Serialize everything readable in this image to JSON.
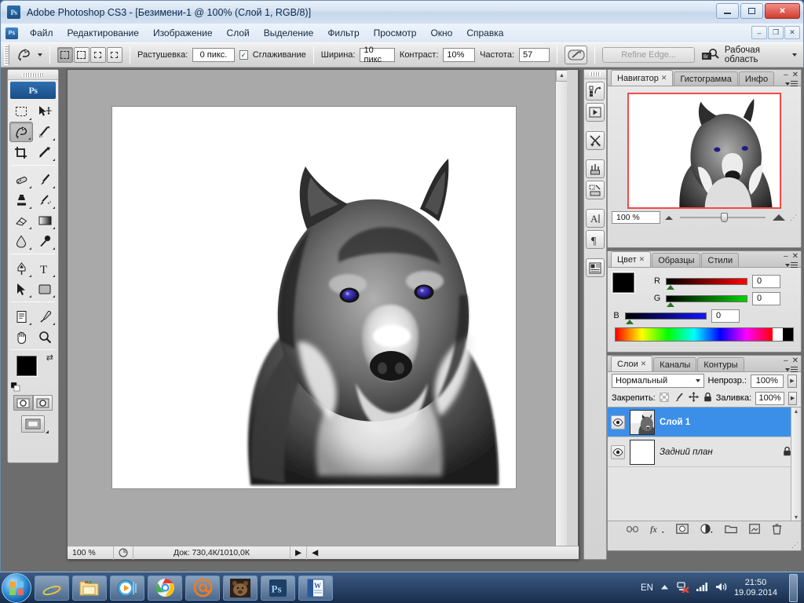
{
  "window": {
    "app_icon": "ps-icon",
    "title": "Adobe Photoshop CS3 - [Безимени-1 @ 100% (Слой 1, RGB/8)]",
    "minimize": "–",
    "maximize": "□",
    "close": "✕",
    "doc_minimize": "–",
    "doc_restore": "❐",
    "doc_close": "✕"
  },
  "menu": {
    "items": [
      {
        "label": "Файл"
      },
      {
        "label": "Редактирование"
      },
      {
        "label": "Изображение"
      },
      {
        "label": "Слой"
      },
      {
        "label": "Выделение"
      },
      {
        "label": "Фильтр"
      },
      {
        "label": "Просмотр"
      },
      {
        "label": "Окно"
      },
      {
        "label": "Справка"
      }
    ]
  },
  "options_bar": {
    "tool_preset": "magnetic-lasso-tool",
    "feather_label": "Растушевка:",
    "feather_value": "0 пикс.",
    "antialias_label": "Сглаживание",
    "antialias_checked": true,
    "width_label": "Ширина:",
    "width_value": "10 пикс",
    "contrast_label": "Контраст:",
    "contrast_value": "10%",
    "frequency_label": "Частота:",
    "frequency_value": "57",
    "refine_edge": "Refine Edge...",
    "bridge_button": "go-to-bridge",
    "workspace_label": "Рабочая область"
  },
  "toolbox": {
    "logo": "Ps",
    "tools": [
      {
        "name": "marquee-tool",
        "selected": false
      },
      {
        "name": "move-tool",
        "selected": false
      },
      {
        "name": "lasso-tool",
        "selected": true
      },
      {
        "name": "magic-wand-tool",
        "selected": false
      },
      {
        "name": "crop-tool",
        "selected": false
      },
      {
        "name": "slice-tool",
        "selected": false
      },
      {
        "name": "healing-brush-tool",
        "selected": false
      },
      {
        "name": "brush-tool",
        "selected": false
      },
      {
        "name": "clone-stamp-tool",
        "selected": false
      },
      {
        "name": "history-brush-tool",
        "selected": false
      },
      {
        "name": "eraser-tool",
        "selected": false
      },
      {
        "name": "gradient-tool",
        "selected": false
      },
      {
        "name": "blur-tool",
        "selected": false
      },
      {
        "name": "dodge-tool",
        "selected": false
      },
      {
        "name": "pen-tool",
        "selected": false
      },
      {
        "name": "type-tool",
        "selected": false
      },
      {
        "name": "path-selection-tool",
        "selected": false
      },
      {
        "name": "shape-tool",
        "selected": false
      },
      {
        "name": "notes-tool",
        "selected": false
      },
      {
        "name": "eyedropper-tool",
        "selected": false
      },
      {
        "name": "hand-tool",
        "selected": false
      },
      {
        "name": "zoom-tool",
        "selected": false
      }
    ],
    "foreground_color": "#000000",
    "background_color": "#ffffff"
  },
  "icon_strip": {
    "buttons": [
      {
        "name": "history-panel-icon"
      },
      {
        "name": "actions-panel-icon"
      },
      {
        "name": "tool-presets-panel-icon"
      },
      {
        "name": "brushes-panel-icon"
      },
      {
        "name": "clone-source-panel-icon"
      },
      {
        "name": "character-panel-icon"
      },
      {
        "name": "paragraph-panel-icon"
      },
      {
        "name": "layer-comps-panel-icon"
      }
    ]
  },
  "navigator_panel": {
    "tabs": [
      {
        "label": "Навигатор",
        "active": true,
        "closable": true
      },
      {
        "label": "Гистограмма",
        "active": false,
        "closable": false
      },
      {
        "label": "Инфо",
        "active": false,
        "closable": false
      }
    ],
    "zoom_value": "100 %",
    "view_box_color": "#f04a4a"
  },
  "color_panel": {
    "tabs": [
      {
        "label": "Цвет",
        "active": true,
        "closable": true
      },
      {
        "label": "Образцы",
        "active": false,
        "closable": false
      },
      {
        "label": "Стили",
        "active": false,
        "closable": false
      }
    ],
    "channels": [
      {
        "label": "R",
        "value": "0"
      },
      {
        "label": "G",
        "value": "0"
      },
      {
        "label": "B",
        "value": "0"
      }
    ],
    "foreground_color": "#000000",
    "background_color": "#ffffff"
  },
  "layers_panel": {
    "tabs": [
      {
        "label": "Слои",
        "active": true,
        "closable": true
      },
      {
        "label": "Каналы",
        "active": false,
        "closable": false
      },
      {
        "label": "Контуры",
        "active": false,
        "closable": false
      }
    ],
    "blend_mode": "Нормальный",
    "opacity_label": "Непрозр.:",
    "opacity_value": "100%",
    "lock_label": "Закрепить:",
    "lock_icons": [
      "lock-transparency-icon",
      "lock-pixels-icon",
      "lock-position-icon",
      "lock-all-icon"
    ],
    "fill_label": "Заливка:",
    "fill_value": "100%",
    "layers": [
      {
        "name": "Слой 1",
        "selected": true,
        "visible": true,
        "locked": false,
        "thumb": "wolf-cutout"
      },
      {
        "name": "Задний план",
        "selected": false,
        "visible": true,
        "locked": true,
        "thumb": "white"
      }
    ],
    "footer_buttons": [
      {
        "name": "link-layers-icon"
      },
      {
        "name": "layer-style-fx-icon"
      },
      {
        "name": "add-layer-mask-icon"
      },
      {
        "name": "adjustment-layer-icon"
      },
      {
        "name": "new-group-icon"
      },
      {
        "name": "new-layer-icon"
      },
      {
        "name": "delete-layer-icon"
      }
    ]
  },
  "status_bar": {
    "zoom": "100 %",
    "doc_info": "Док: 730,4К/1010,0К"
  },
  "canvas": {
    "subject": "wolf-head-grayscale",
    "background": "#ffffff",
    "eye_color": "#2a1f8f"
  },
  "taskbar": {
    "start": "start-orb",
    "buttons": [
      {
        "name": "internet-explorer-icon",
        "glyph": "e"
      },
      {
        "name": "windows-explorer-icon",
        "glyph": "folder"
      },
      {
        "name": "media-player-icon",
        "glyph": "play"
      },
      {
        "name": "google-chrome-icon",
        "glyph": "chrome"
      },
      {
        "name": "mail-icon",
        "glyph": "@"
      },
      {
        "name": "image-viewer-icon",
        "glyph": "bear-photo"
      },
      {
        "name": "photoshop-icon",
        "glyph": "Ps"
      },
      {
        "name": "word-icon",
        "glyph": "W"
      }
    ],
    "language": "EN",
    "tray_icons": [
      "show-hidden-icons",
      "network-disconnected-icon",
      "signal-icon",
      "volume-icon"
    ],
    "time": "21:50",
    "date": "19.09.2014"
  }
}
